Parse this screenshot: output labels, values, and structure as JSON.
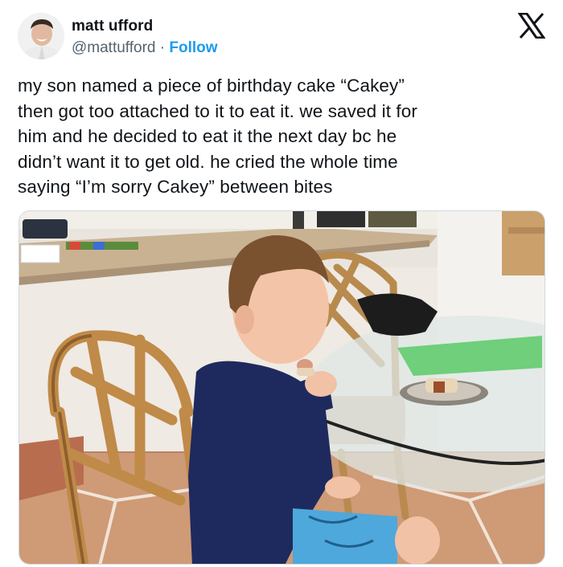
{
  "author": {
    "name": "matt ufford",
    "handle": "@mattufford",
    "separator": "·",
    "follow_label": "Follow"
  },
  "icons": {
    "platform": "x-logo-icon",
    "avatar": "avatar-photo"
  },
  "tweet": {
    "text": "my son named a piece of birthday cake “Cakey”\nthen got too attached to it to eat it. we saved it for\nhim and he decided to eat it the next day bc he\ndidn’t want it to get old. he cried the whole time\nsaying “I’m sorry Cakey” between bites"
  },
  "colors": {
    "text": "#0f1419",
    "secondary": "#536471",
    "accent": "#1d9bf0"
  }
}
